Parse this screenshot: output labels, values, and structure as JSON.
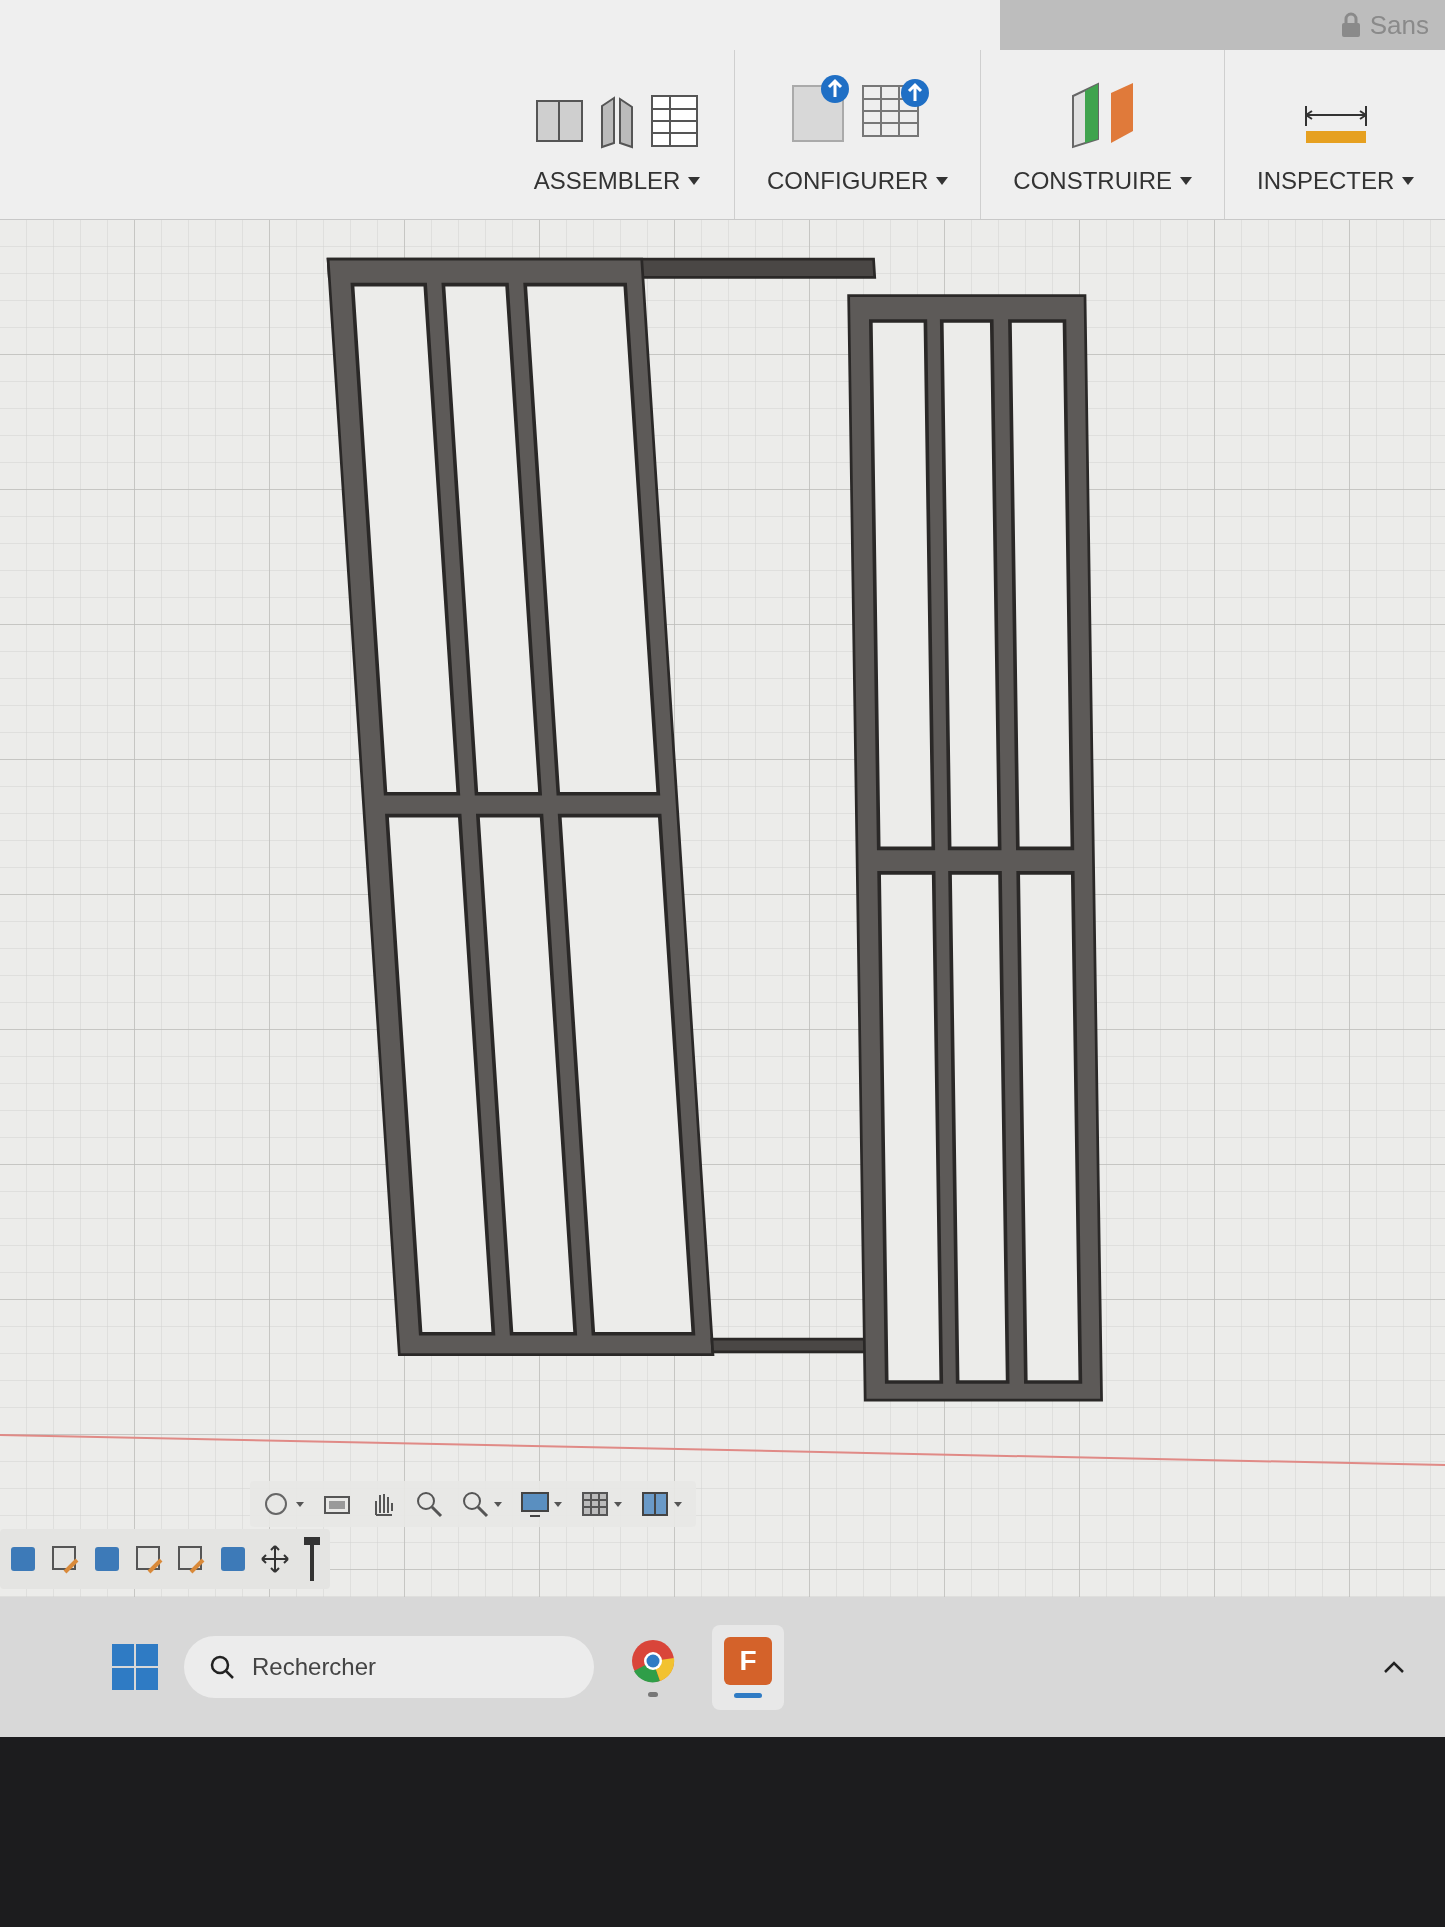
{
  "document_tab": {
    "title": "Sans"
  },
  "toolbar": {
    "groups": [
      {
        "kind": "assemble",
        "label": "ASSEMBLER"
      },
      {
        "kind": "configure",
        "label": "CONFIGURER"
      },
      {
        "kind": "construct",
        "label": "CONSTRUIRE"
      },
      {
        "kind": "inspect",
        "label": "INSPECTER"
      }
    ]
  },
  "taskbar": {
    "search": {
      "placeholder": "Rechercher"
    },
    "apps": [
      {
        "kind": "chrome",
        "selected": false
      },
      {
        "kind": "fusion",
        "label": "F",
        "selected": true
      }
    ]
  }
}
